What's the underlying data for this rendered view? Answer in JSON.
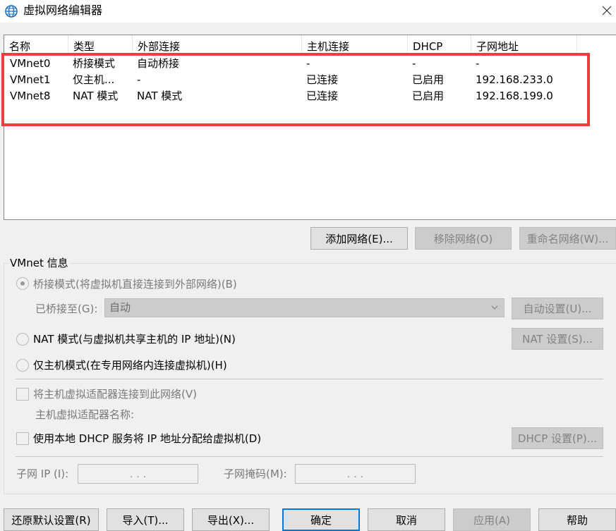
{
  "window": {
    "title": "虚拟网络编辑器",
    "app_icon": "globe-icon",
    "close_icon": "close-icon"
  },
  "list": {
    "columns": [
      "名称",
      "类型",
      "外部连接",
      "主机连接",
      "DHCP",
      "子网地址"
    ],
    "rows": [
      [
        "VMnet0",
        "桥接模式",
        "自动桥接",
        "-",
        "-",
        "-"
      ],
      [
        "VMnet1",
        "仅主机...",
        "-",
        "已连接",
        "已启用",
        "192.168.233.0"
      ],
      [
        "VMnet8",
        "NAT 模式",
        "NAT 模式",
        "已连接",
        "已启用",
        "192.168.199.0"
      ]
    ],
    "highlight_color": "#ef3e42"
  },
  "list_buttons": {
    "add": "添加网络(E)...",
    "remove": "移除网络(O)",
    "rename": "重命名网络(W)..."
  },
  "vmnet_info": {
    "group_label": "VMnet 信息",
    "bridged_radio": "桥接模式(将虚拟机直接连接到外部网络)(B)",
    "bridged_to_label": "已桥接至(G):",
    "bridged_to_value": "自动",
    "auto_settings": "自动设置(U)...",
    "nat_radio": "NAT 模式(与虚拟机共享主机的 IP 地址)(N)",
    "nat_settings": "NAT 设置(S)...",
    "hostonly_radio": "仅主机模式(在专用网络内连接虚拟机)(H)",
    "connect_adapter_check": "将主机虚拟适配器连接到此网络(V)",
    "adapter_name_label": "主机虚拟适配器名称:",
    "dhcp_check": "使用本地 DHCP 服务将 IP 地址分配给虚拟机(D)",
    "dhcp_settings": "DHCP 设置(P)...",
    "subnet_ip_label": "子网 IP (I):",
    "subnet_mask_label": "子网掩码(M):",
    "ip_dots": ". . ."
  },
  "footer": {
    "restore": "还原默认设置(R)",
    "import": "导入(T)...",
    "export": "导出(X)...",
    "ok": "确定",
    "cancel": "取消",
    "apply": "应用(A)",
    "help": "帮助"
  }
}
